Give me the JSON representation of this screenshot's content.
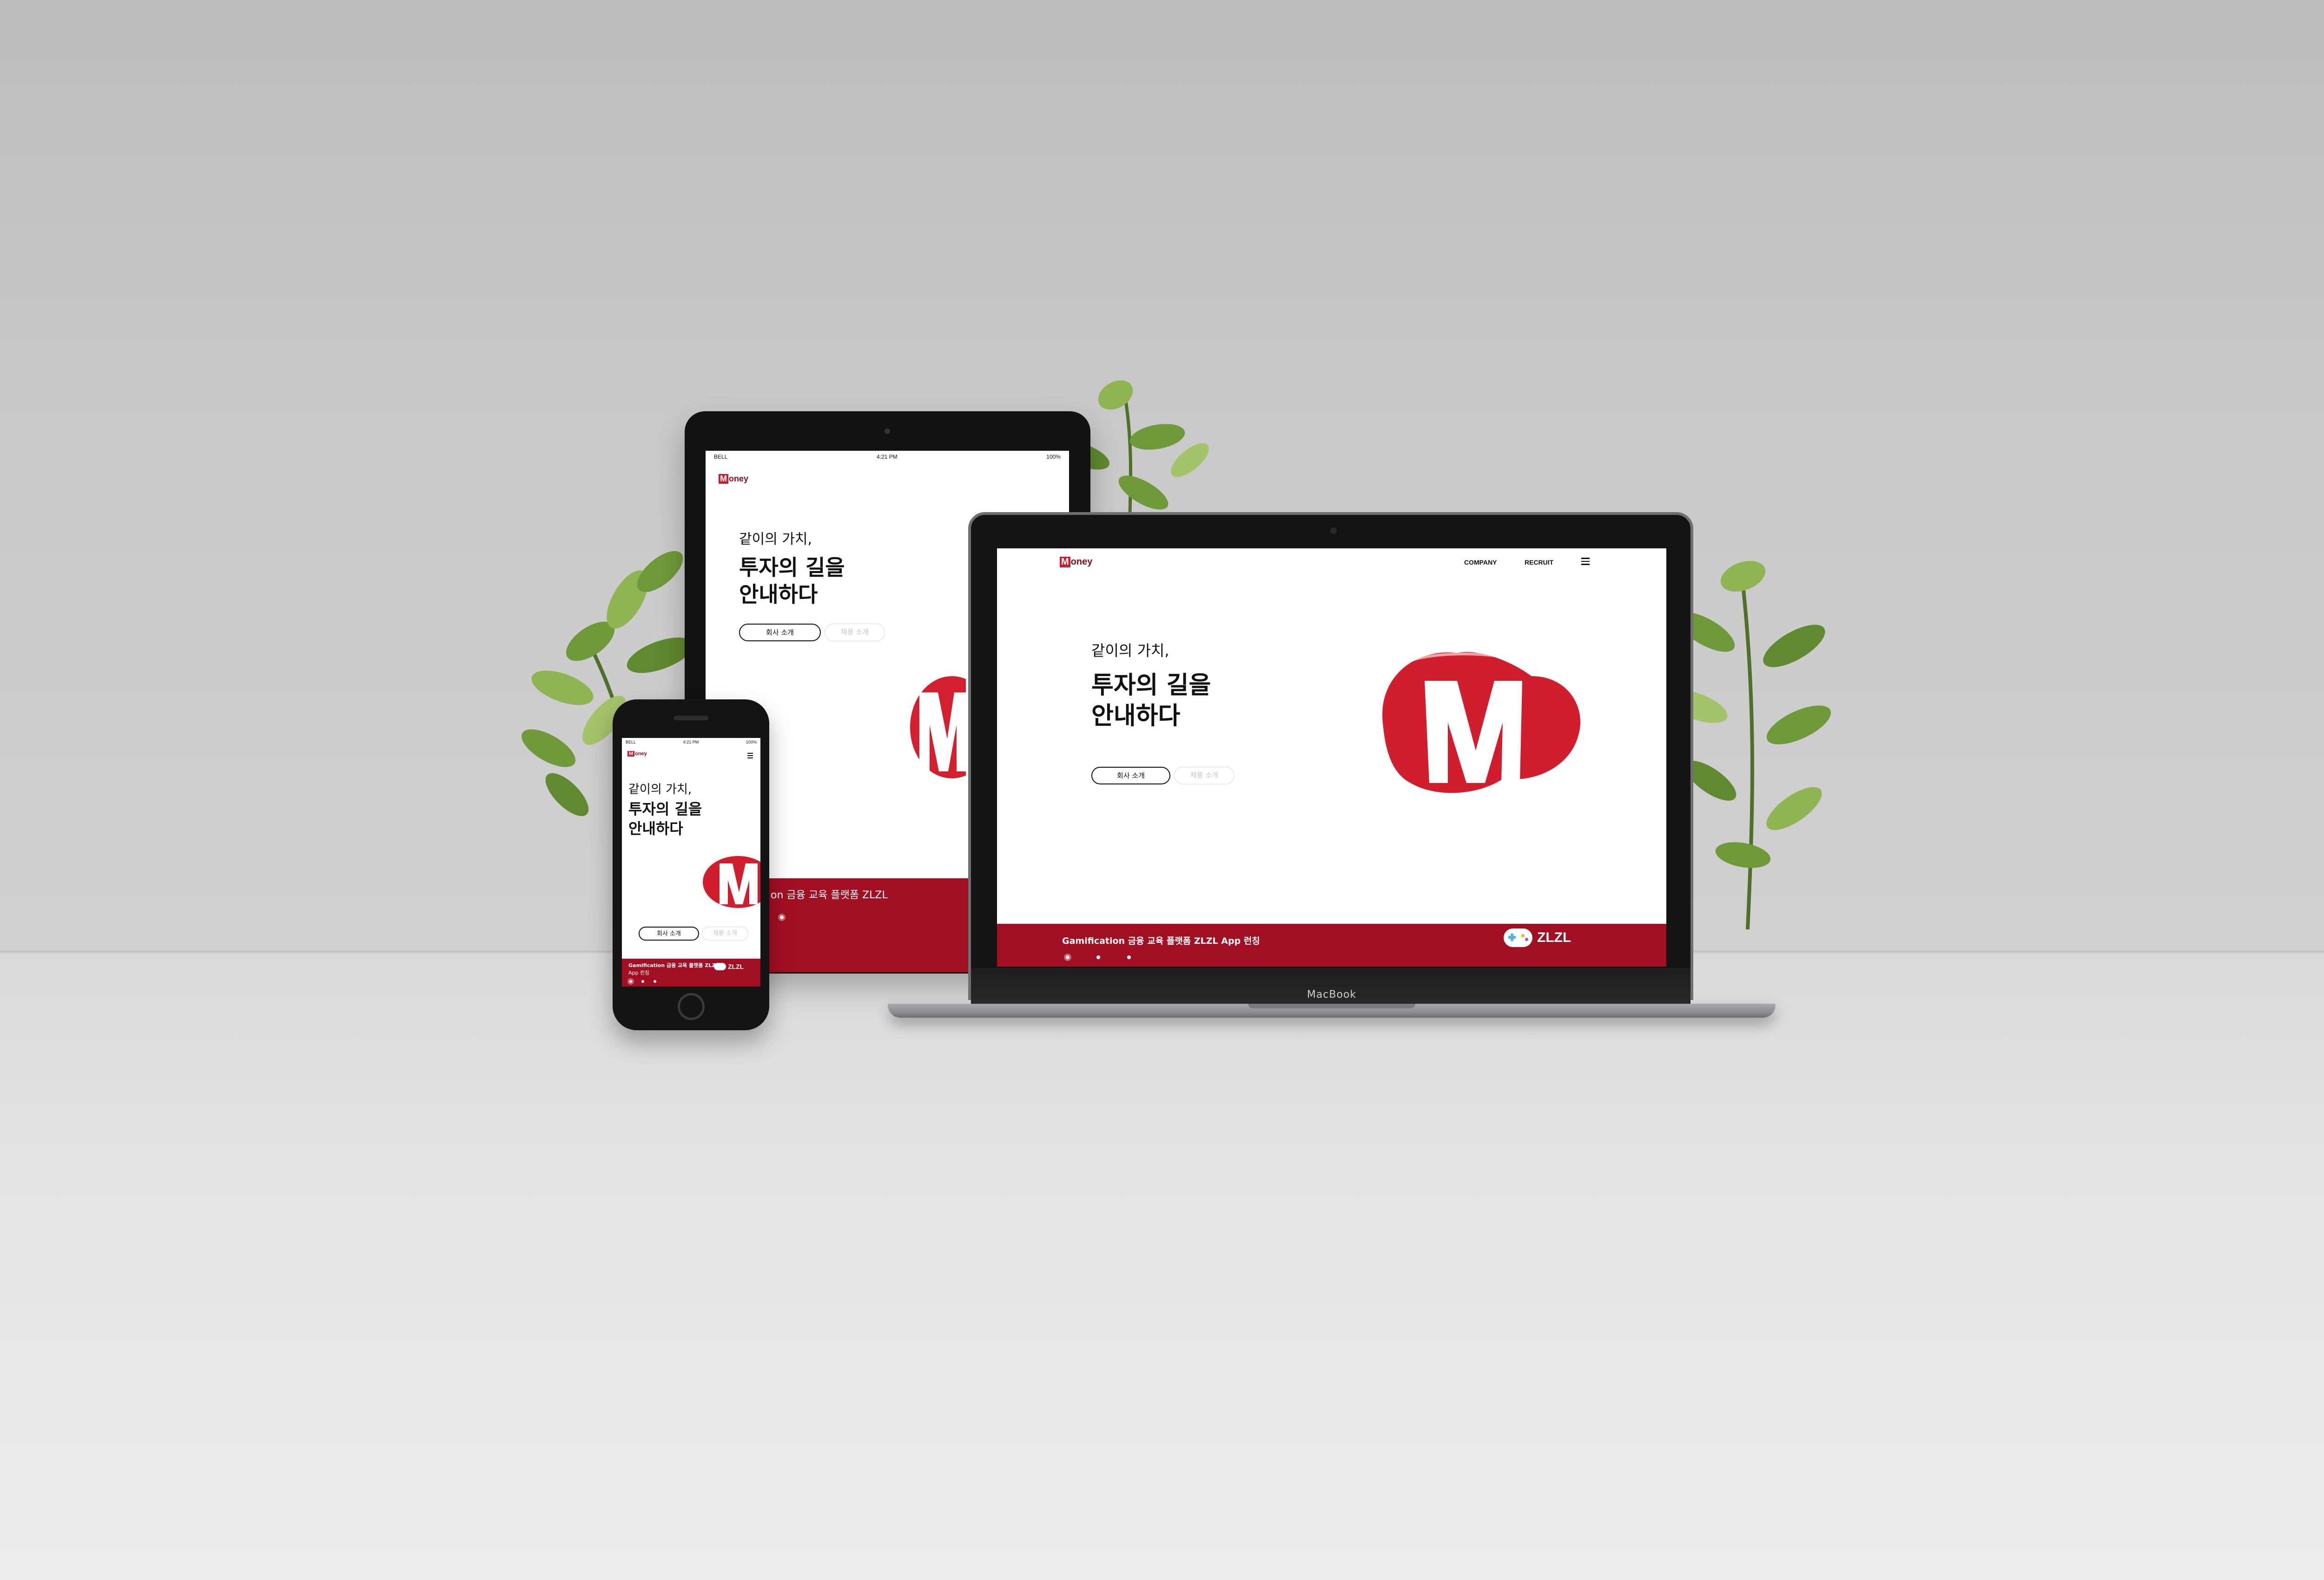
{
  "brand": {
    "logo_prefix": "M",
    "logo_text": "oney"
  },
  "laptop": {
    "device_label": "MacBook",
    "nav": [
      "COMPANY",
      "RECRUIT"
    ],
    "hero_line1": "같이의 가치,",
    "hero_line2": "투자의 길을",
    "hero_line3": "안내하다",
    "btn_primary": "회사 소개",
    "btn_secondary": "채용 소개",
    "banner_text": "Gamification 금융 교육 플랫폼 ZLZL App 런칭",
    "app_badge": "ZLZL"
  },
  "tablet": {
    "status_carrier": "BELL",
    "status_time": "4:21 PM",
    "status_battery": "100%",
    "hero_line1": "같이의 가치,",
    "hero_line2": "투자의 길을",
    "hero_line3": "안내하다",
    "btn_primary": "회사 소개",
    "btn_secondary": "채용 소개",
    "banner_text": "on 금융 교육 플랫폼 ZLZL"
  },
  "phone": {
    "status_carrier": "BELL",
    "status_time": "4:21 PM",
    "status_battery": "100%",
    "hero_line1": "같이의 가치,",
    "hero_line2": "투자의 길을",
    "hero_line3": "안내하다",
    "btn_primary": "회사 소개",
    "btn_secondary": "채용 소개",
    "banner_text_line1": "Gamification 금융 교육 플랫폼 ZLZL",
    "banner_text_line2": "App 런칭",
    "app_badge": "ZLZL"
  },
  "colors": {
    "brand_red": "#c81f2d",
    "banner_red": "#a30f22",
    "wall": "#c9c9c9"
  }
}
